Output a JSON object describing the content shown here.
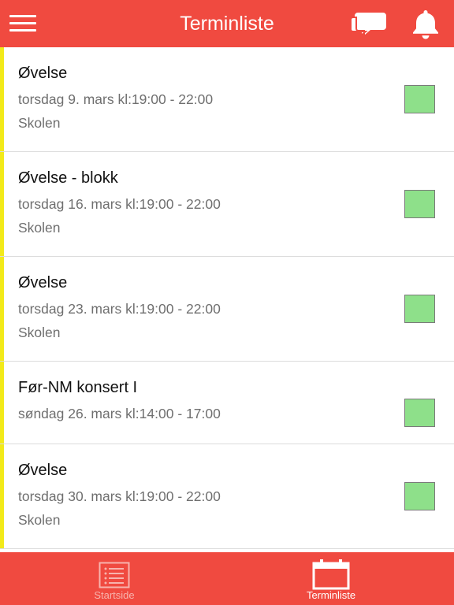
{
  "header": {
    "title": "Terminliste",
    "background": "#f04a40",
    "icons": {
      "menu": "hamburger-menu-icon",
      "chat": "chat-bubbles-icon",
      "bell": "bell-icon"
    }
  },
  "events": [
    {
      "name": "Øvelse",
      "datetime": "torsdag 9. mars kl:19:00 - 22:00",
      "location": "Skolen",
      "status_color": "#8ee08a"
    },
    {
      "name": "Øvelse - blokk",
      "datetime": "torsdag 16. mars kl:19:00 - 22:00",
      "location": "Skolen",
      "status_color": "#8ee08a"
    },
    {
      "name": "Øvelse",
      "datetime": "torsdag 23. mars kl:19:00 - 22:00",
      "location": "Skolen",
      "status_color": "#8ee08a"
    },
    {
      "name": "Før-NM konsert I",
      "datetime": "søndag 26. mars kl:14:00 - 17:00",
      "location": "",
      "status_color": "#8ee08a"
    },
    {
      "name": "Øvelse",
      "datetime": "torsdag 30. mars kl:19:00 - 22:00",
      "location": "Skolen",
      "status_color": "#8ee08a"
    }
  ],
  "tabbar": {
    "tabs": [
      {
        "label": "Startside",
        "icon": "list-icon",
        "active": false
      },
      {
        "label": "Terminliste",
        "icon": "calendar-icon",
        "active": true
      }
    ]
  },
  "colors": {
    "accent": "#f04a40",
    "event_marker": "#f2ea1a",
    "status_ok": "#8ee08a"
  }
}
